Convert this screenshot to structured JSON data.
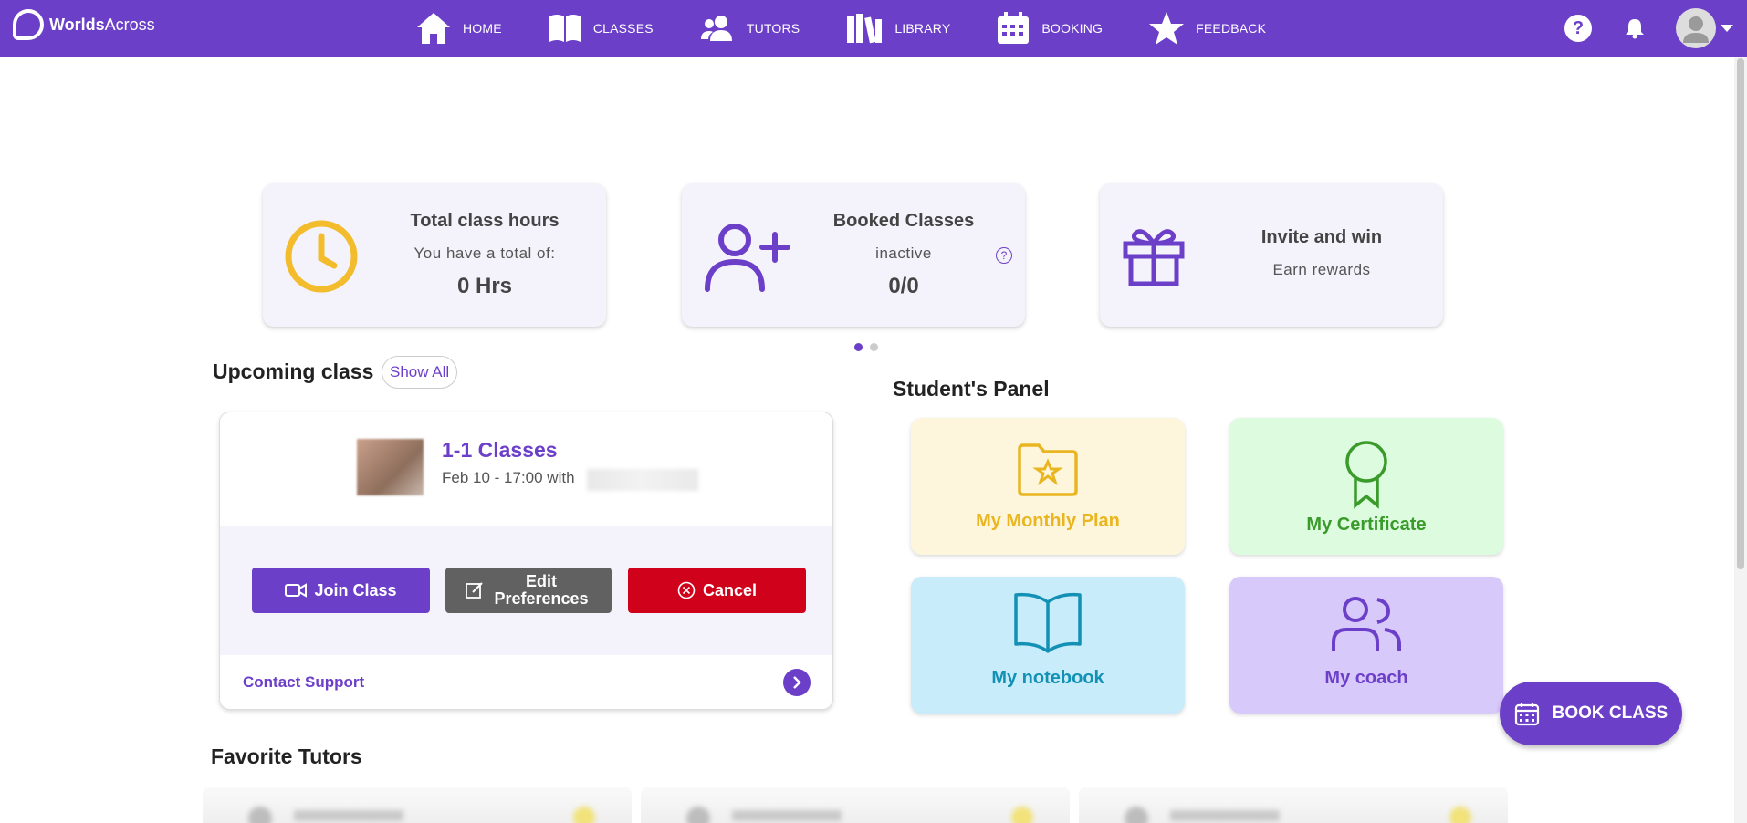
{
  "app": {
    "logo_text_bold": "Worlds",
    "logo_text_light": "Across"
  },
  "nav": {
    "items": [
      {
        "label": "HOME",
        "icon": "home-icon"
      },
      {
        "label": "CLASSES",
        "icon": "book-open-icon"
      },
      {
        "label": "TUTORS",
        "icon": "users-icon"
      },
      {
        "label": "LIBRARY",
        "icon": "library-icon"
      },
      {
        "label": "BOOKING",
        "icon": "calendar-icon"
      },
      {
        "label": "FEEDBACK",
        "icon": "star-icon"
      }
    ],
    "help_label": "?"
  },
  "stats": {
    "hours": {
      "title": "Total class hours",
      "subtitle": "You have a total of:",
      "value": "0 Hrs",
      "icon": "clock-icon"
    },
    "booked": {
      "title": "Booked Classes",
      "subtitle": "inactive",
      "value": "0/0",
      "icon": "user-plus-icon",
      "help": "?"
    },
    "invite": {
      "title": "Invite and win",
      "subtitle": "Earn rewards",
      "icon": "gift-icon"
    }
  },
  "upcoming": {
    "title": "Upcoming class",
    "show_all": "Show All",
    "class_name": "1-1 Classes",
    "class_time": "Feb 10 - 17:00 with",
    "buttons": {
      "join": "Join Class",
      "edit": "Edit Preferences",
      "cancel": "Cancel"
    },
    "contact": "Contact Support"
  },
  "student_panel": {
    "title": "Student's Panel",
    "tiles": {
      "plan": "My Monthly Plan",
      "certificate": "My Certificate",
      "notebook": "My notebook",
      "coach": "My coach"
    }
  },
  "book_class": "BOOK CLASS",
  "favorites": {
    "title": "Favorite Tutors"
  },
  "colors": {
    "brand": "#6c3fc9",
    "cancel": "#d0021b",
    "edit": "#616161",
    "clock": "#f2bc2c"
  }
}
